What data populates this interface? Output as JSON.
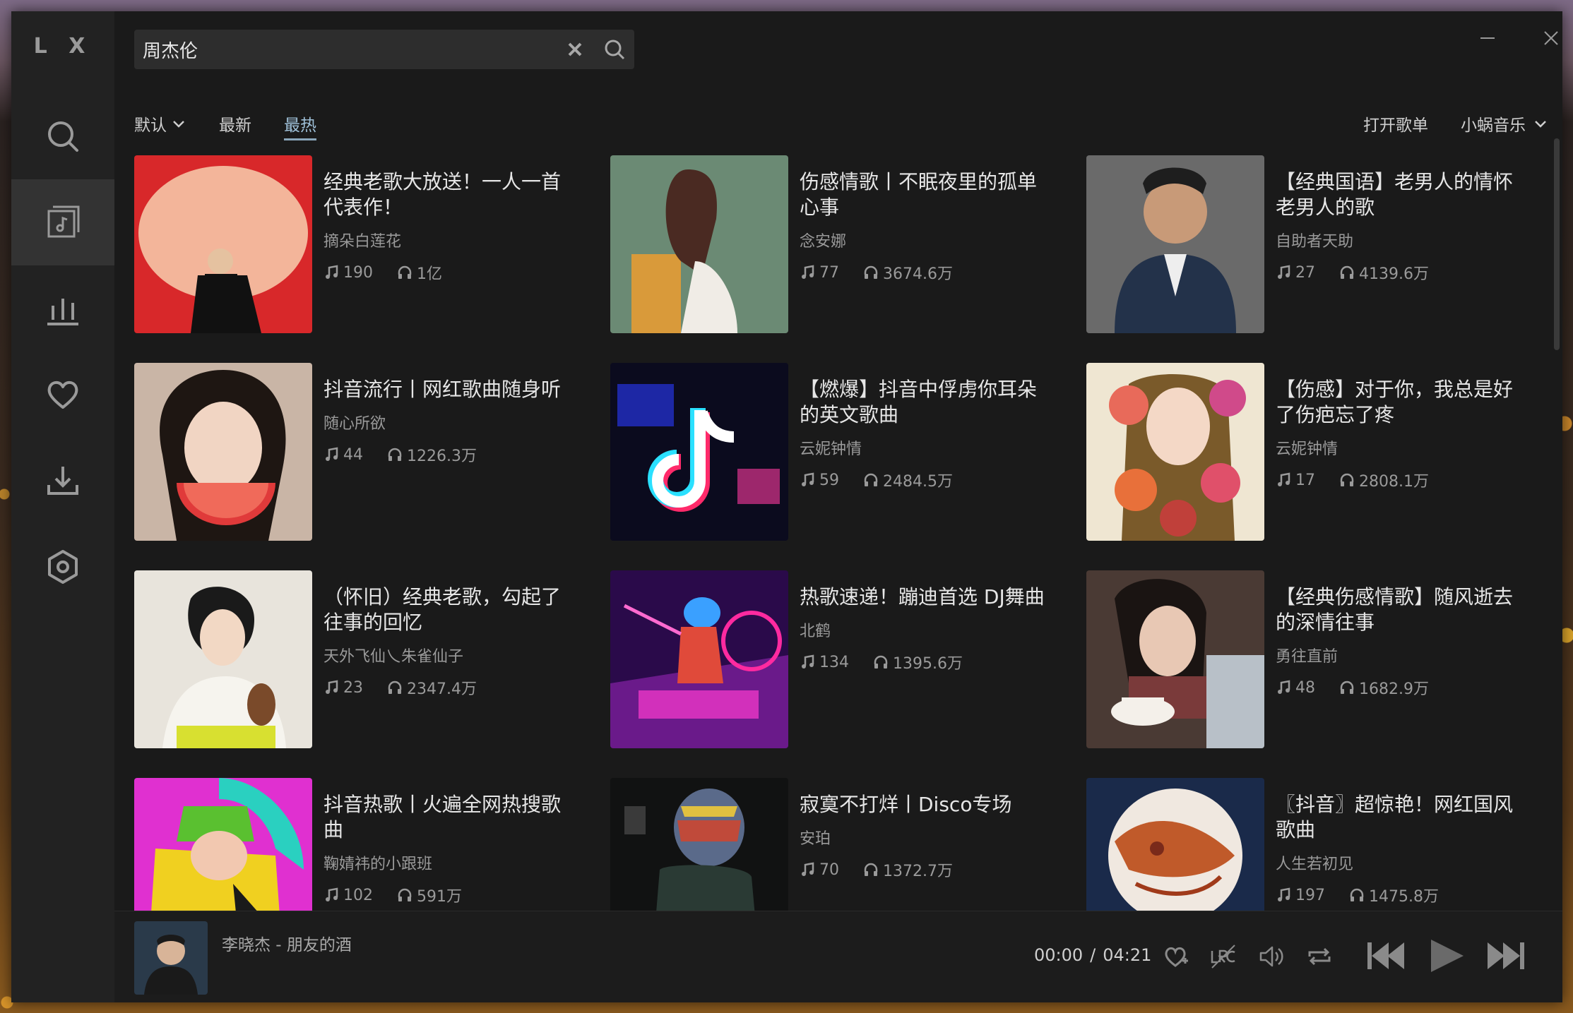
{
  "app": {
    "logo": "L X"
  },
  "search": {
    "value": "周杰伦"
  },
  "sort": {
    "default_label": "默认",
    "newest_label": "最新",
    "hottest_label": "最热"
  },
  "toolbar": {
    "open_playlist": "打开歌单",
    "source": "小蜗音乐"
  },
  "playlists": [
    {
      "title": "经典老歌大放送！一人一首代表作！",
      "author": "摘朵白莲花",
      "songs": "190",
      "plays": "1亿"
    },
    {
      "title": "伤感情歌丨不眠夜里的孤单心事",
      "author": "念安娜",
      "songs": "77",
      "plays": "3674.6万"
    },
    {
      "title": "【经典国语】老男人的情怀 老男人的歌",
      "author": "自助者天助",
      "songs": "27",
      "plays": "4139.6万"
    },
    {
      "title": "抖音流行丨网红歌曲随身听",
      "author": "随心所欲",
      "songs": "44",
      "plays": "1226.3万"
    },
    {
      "title": "【燃爆】抖音中俘虏你耳朵的英文歌曲",
      "author": "云妮钟情",
      "songs": "59",
      "plays": "2484.5万"
    },
    {
      "title": "【伤感】对于你，我总是好了伤疤忘了疼",
      "author": "云妮钟情",
      "songs": "17",
      "plays": "2808.1万"
    },
    {
      "title": "（怀旧）经典老歌，勾起了往事的回忆",
      "author": "天外飞仙乀朱雀仙子",
      "songs": "23",
      "plays": "2347.4万"
    },
    {
      "title": "热歌速递！蹦迪首选 DJ舞曲",
      "author": "北鹤",
      "songs": "134",
      "plays": "1395.6万"
    },
    {
      "title": "【经典伤感情歌】随风逝去的深情往事",
      "author": "勇往直前",
      "songs": "48",
      "plays": "1682.9万"
    },
    {
      "title": "抖音热歌丨火遍全网热搜歌曲",
      "author": "鞠婧祎的小跟班",
      "songs": "102",
      "plays": "591万"
    },
    {
      "title": "寂寞不打烊丨Disco专场",
      "author": "安珀",
      "songs": "70",
      "plays": "1372.7万"
    },
    {
      "title": "〖抖音〗超惊艳！网红国风歌曲",
      "author": "人生若初见",
      "songs": "197",
      "plays": "1475.8万"
    }
  ],
  "player": {
    "now_playing": "李晓杰 - 朋友的酒",
    "current_time": "00:00",
    "separator": "/",
    "duration": "04:21"
  },
  "colors": {
    "accent": "#8aa6bb",
    "background": "#1a1a1a",
    "sidebar": "#222222"
  }
}
